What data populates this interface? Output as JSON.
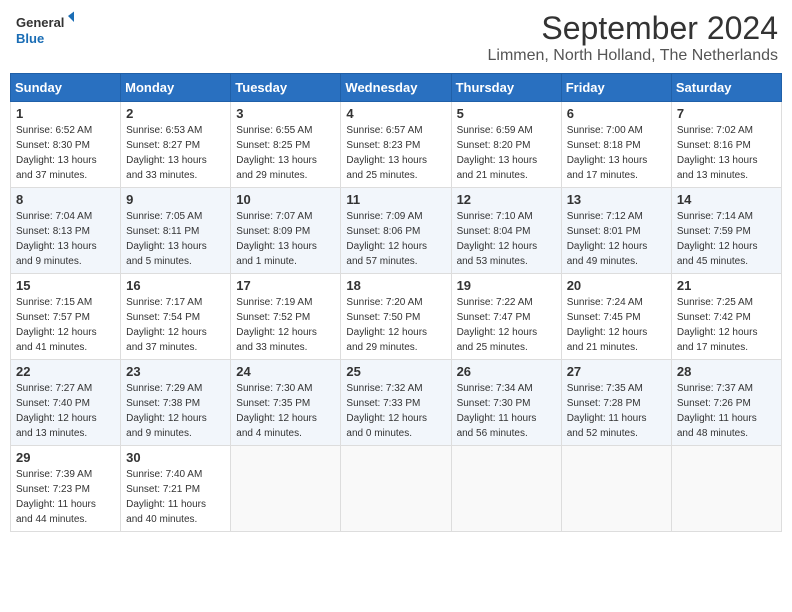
{
  "logo": {
    "text_general": "General",
    "text_blue": "Blue"
  },
  "header": {
    "month_year": "September 2024",
    "location": "Limmen, North Holland, The Netherlands"
  },
  "weekdays": [
    "Sunday",
    "Monday",
    "Tuesday",
    "Wednesday",
    "Thursday",
    "Friday",
    "Saturday"
  ],
  "weeks": [
    [
      {
        "day": "1",
        "sunrise": "6:52 AM",
        "sunset": "8:30 PM",
        "daylight": "13 hours and 37 minutes."
      },
      {
        "day": "2",
        "sunrise": "6:53 AM",
        "sunset": "8:27 PM",
        "daylight": "13 hours and 33 minutes."
      },
      {
        "day": "3",
        "sunrise": "6:55 AM",
        "sunset": "8:25 PM",
        "daylight": "13 hours and 29 minutes."
      },
      {
        "day": "4",
        "sunrise": "6:57 AM",
        "sunset": "8:23 PM",
        "daylight": "13 hours and 25 minutes."
      },
      {
        "day": "5",
        "sunrise": "6:59 AM",
        "sunset": "8:20 PM",
        "daylight": "13 hours and 21 minutes."
      },
      {
        "day": "6",
        "sunrise": "7:00 AM",
        "sunset": "8:18 PM",
        "daylight": "13 hours and 17 minutes."
      },
      {
        "day": "7",
        "sunrise": "7:02 AM",
        "sunset": "8:16 PM",
        "daylight": "13 hours and 13 minutes."
      }
    ],
    [
      {
        "day": "8",
        "sunrise": "7:04 AM",
        "sunset": "8:13 PM",
        "daylight": "13 hours and 9 minutes."
      },
      {
        "day": "9",
        "sunrise": "7:05 AM",
        "sunset": "8:11 PM",
        "daylight": "13 hours and 5 minutes."
      },
      {
        "day": "10",
        "sunrise": "7:07 AM",
        "sunset": "8:09 PM",
        "daylight": "13 hours and 1 minute."
      },
      {
        "day": "11",
        "sunrise": "7:09 AM",
        "sunset": "8:06 PM",
        "daylight": "12 hours and 57 minutes."
      },
      {
        "day": "12",
        "sunrise": "7:10 AM",
        "sunset": "8:04 PM",
        "daylight": "12 hours and 53 minutes."
      },
      {
        "day": "13",
        "sunrise": "7:12 AM",
        "sunset": "8:01 PM",
        "daylight": "12 hours and 49 minutes."
      },
      {
        "day": "14",
        "sunrise": "7:14 AM",
        "sunset": "7:59 PM",
        "daylight": "12 hours and 45 minutes."
      }
    ],
    [
      {
        "day": "15",
        "sunrise": "7:15 AM",
        "sunset": "7:57 PM",
        "daylight": "12 hours and 41 minutes."
      },
      {
        "day": "16",
        "sunrise": "7:17 AM",
        "sunset": "7:54 PM",
        "daylight": "12 hours and 37 minutes."
      },
      {
        "day": "17",
        "sunrise": "7:19 AM",
        "sunset": "7:52 PM",
        "daylight": "12 hours and 33 minutes."
      },
      {
        "day": "18",
        "sunrise": "7:20 AM",
        "sunset": "7:50 PM",
        "daylight": "12 hours and 29 minutes."
      },
      {
        "day": "19",
        "sunrise": "7:22 AM",
        "sunset": "7:47 PM",
        "daylight": "12 hours and 25 minutes."
      },
      {
        "day": "20",
        "sunrise": "7:24 AM",
        "sunset": "7:45 PM",
        "daylight": "12 hours and 21 minutes."
      },
      {
        "day": "21",
        "sunrise": "7:25 AM",
        "sunset": "7:42 PM",
        "daylight": "12 hours and 17 minutes."
      }
    ],
    [
      {
        "day": "22",
        "sunrise": "7:27 AM",
        "sunset": "7:40 PM",
        "daylight": "12 hours and 13 minutes."
      },
      {
        "day": "23",
        "sunrise": "7:29 AM",
        "sunset": "7:38 PM",
        "daylight": "12 hours and 9 minutes."
      },
      {
        "day": "24",
        "sunrise": "7:30 AM",
        "sunset": "7:35 PM",
        "daylight": "12 hours and 4 minutes."
      },
      {
        "day": "25",
        "sunrise": "7:32 AM",
        "sunset": "7:33 PM",
        "daylight": "12 hours and 0 minutes."
      },
      {
        "day": "26",
        "sunrise": "7:34 AM",
        "sunset": "7:30 PM",
        "daylight": "11 hours and 56 minutes."
      },
      {
        "day": "27",
        "sunrise": "7:35 AM",
        "sunset": "7:28 PM",
        "daylight": "11 hours and 52 minutes."
      },
      {
        "day": "28",
        "sunrise": "7:37 AM",
        "sunset": "7:26 PM",
        "daylight": "11 hours and 48 minutes."
      }
    ],
    [
      {
        "day": "29",
        "sunrise": "7:39 AM",
        "sunset": "7:23 PM",
        "daylight": "11 hours and 44 minutes."
      },
      {
        "day": "30",
        "sunrise": "7:40 AM",
        "sunset": "7:21 PM",
        "daylight": "11 hours and 40 minutes."
      },
      null,
      null,
      null,
      null,
      null
    ]
  ]
}
